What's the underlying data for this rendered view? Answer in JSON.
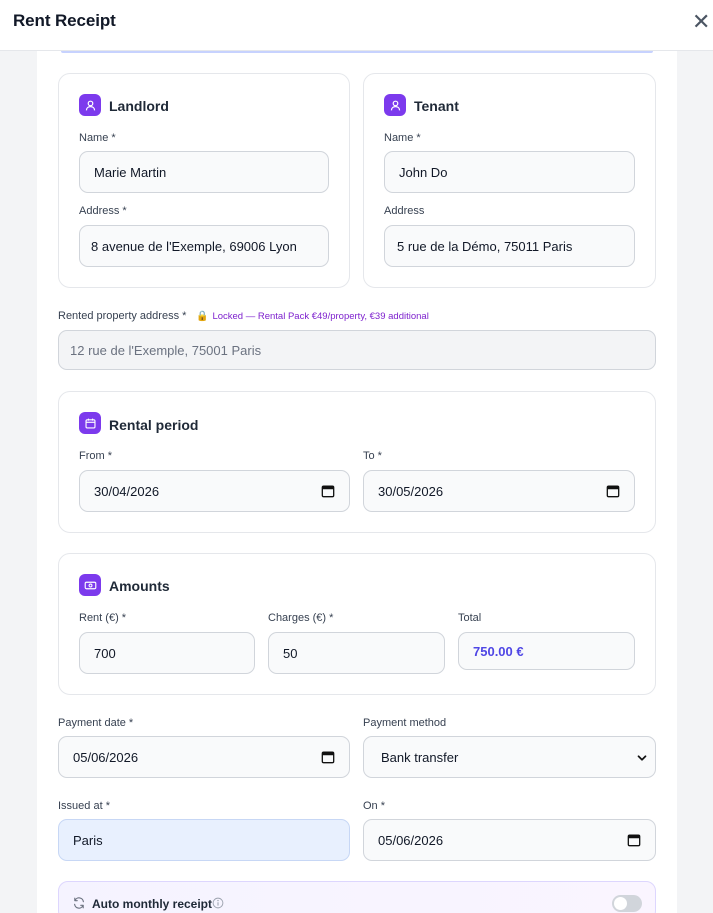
{
  "header": {
    "title": "Rent Receipt",
    "close_glyph": "✕"
  },
  "landlord": {
    "title": "Landlord",
    "name_label": "Name *",
    "name_value": "Marie Martin",
    "address_label": "Address *",
    "address_value": "8 avenue de l'Exemple, 69006 Lyon"
  },
  "tenant": {
    "title": "Tenant",
    "name_label": "Name *",
    "name_value": "John Do",
    "address_label": "Address",
    "address_value": "5 rue de la Démo, 75011 Paris"
  },
  "property": {
    "label": "Rented property address *",
    "lock_note": "Locked — Rental Pack €49/property, €39 additional",
    "value": "12 rue de l'Exemple, 75001 Paris"
  },
  "period": {
    "title": "Rental period",
    "from_label": "From *",
    "from_value": "30/04/2026",
    "to_label": "To *",
    "to_value": "30/05/2026"
  },
  "amounts": {
    "title": "Amounts",
    "rent_label": "Rent (€) *",
    "rent_value": "700",
    "charges_label": "Charges (€) *",
    "charges_value": "50",
    "total_label": "Total",
    "total_value": "750.00 €"
  },
  "payment": {
    "date_label": "Payment date *",
    "date_value": "05/06/2026",
    "method_label": "Payment method",
    "method_value": "Bank transfer"
  },
  "issue": {
    "place_label": "Issued at *",
    "place_value": "Paris",
    "on_label": "On *",
    "on_value": "05/06/2026"
  },
  "auto": {
    "label": "Auto monthly receipt",
    "enabled": false
  },
  "colors": {
    "accent": "#7c3aed",
    "total": "#4f46e5",
    "lock_note": "#7e22ce"
  }
}
